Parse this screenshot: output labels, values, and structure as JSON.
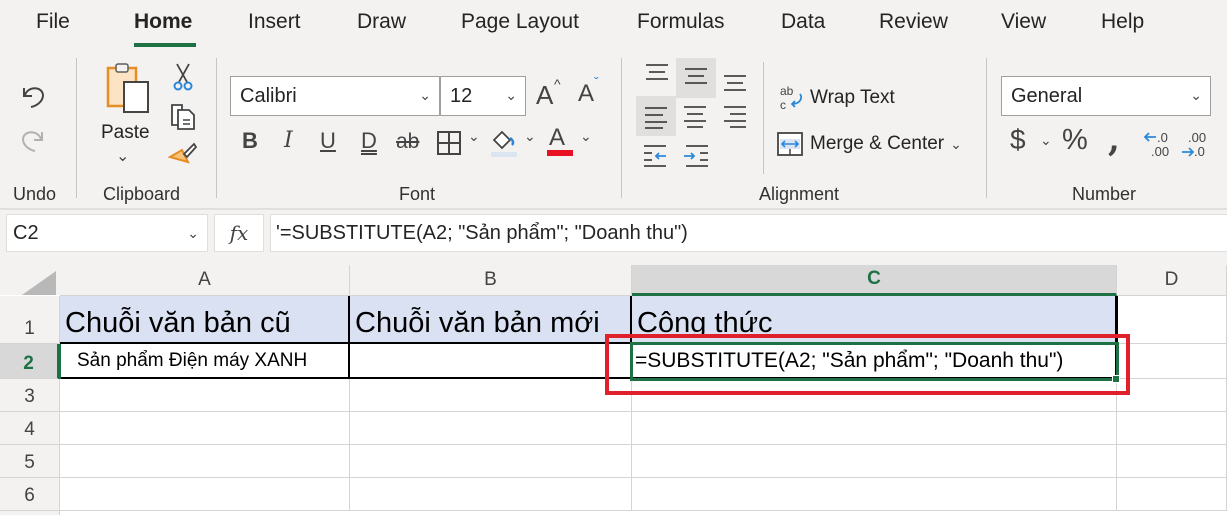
{
  "tabs": [
    {
      "label": "File",
      "active": false
    },
    {
      "label": "Home",
      "active": true
    },
    {
      "label": "Insert",
      "active": false
    },
    {
      "label": "Draw",
      "active": false
    },
    {
      "label": "Page Layout",
      "active": false
    },
    {
      "label": "Formulas",
      "active": false
    },
    {
      "label": "Data",
      "active": false
    },
    {
      "label": "Review",
      "active": false
    },
    {
      "label": "View",
      "active": false
    },
    {
      "label": "Help",
      "active": false
    }
  ],
  "ribbon": {
    "undo_group": {
      "label": "Undo",
      "undo_icon": "undo-icon",
      "redo_icon": "redo-icon"
    },
    "clipboard_group": {
      "label": "Clipboard",
      "paste_label": "Paste",
      "paste_chevron": "⌄"
    },
    "font_group": {
      "label": "Font",
      "font_name": "Calibri",
      "font_size": "12",
      "bold": "B",
      "italic": "I",
      "underline": "U",
      "double_underline": "D",
      "strikethrough": "ab",
      "font_color_letter": "A",
      "grow_letter": "A",
      "shrink_letter": "A",
      "fill_color": "#dbe5f1",
      "font_color": "#e81123"
    },
    "alignment_group": {
      "label": "Alignment",
      "wrap_text": "Wrap Text",
      "merge_center": "Merge & Center"
    },
    "number_group": {
      "label": "Number",
      "format": "General",
      "currency": "$",
      "percent": "%",
      "comma": "❟",
      "increase_decimal_top": ".0",
      "increase_decimal_bottom": ".00",
      "decrease_decimal_top": ".00",
      "decrease_decimal_bottom": ".0"
    }
  },
  "formula_bar": {
    "name_box": "C2",
    "fx_label": "fx",
    "content": "'=SUBSTITUTE(A2; \"Sản phẩm\"; \"Doanh thu\")"
  },
  "grid": {
    "columns": [
      "A",
      "B",
      "C",
      "D"
    ],
    "selected_column": "C",
    "rows": [
      "1",
      "2",
      "3",
      "4",
      "5",
      "6"
    ],
    "selected_row": "2",
    "cells": {
      "A1": "Chuỗi văn bản cũ",
      "B1": "Chuỗi văn bản mới",
      "C1": "Công thức",
      "A2": "Sản phẩm Điện máy XANH",
      "B2": "",
      "C2": "=SUBSTITUTE(A2; \"Sản phẩm\"; \"Doanh thu\")"
    },
    "header_fill": "#d9e1f2",
    "selection_color": "#1e7145",
    "highlight_color": "#e0202b"
  }
}
